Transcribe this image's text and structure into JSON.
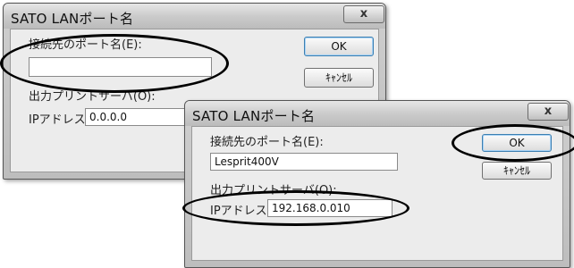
{
  "back_dialog": {
    "title": "SATO LANポート名",
    "close_label": "x",
    "port_label": "接続先のポート名(E):",
    "port_value": "",
    "ok_label": "OK",
    "cancel_label": "ｷｬﾝｾﾙ",
    "server_label": "出力プリントサーバ(O):",
    "ip_label": "IPアドレス:",
    "ip_value": "0.0.0.0"
  },
  "front_dialog": {
    "title": "SATO LANポート名",
    "close_label": "x",
    "port_label": "接続先のポート名(E):",
    "port_value": "Lesprit400V",
    "ok_label": "OK",
    "cancel_label": "ｷｬﾝｾﾙ",
    "server_label": "出力プリントサーバ(O):",
    "ip_label": "IPアドレス:",
    "ip_value": "192.168.0.010"
  }
}
